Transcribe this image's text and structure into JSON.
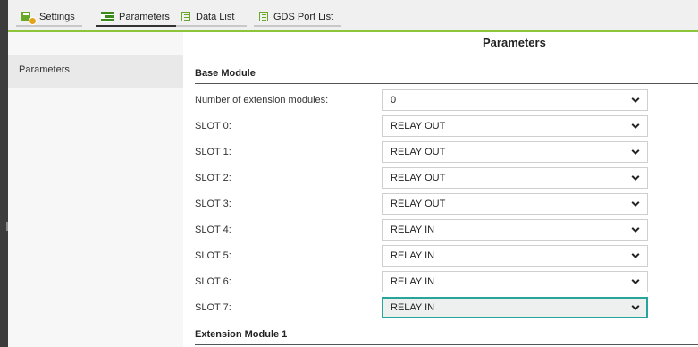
{
  "tabs": [
    {
      "label": "Settings",
      "icon": "settings-icon"
    },
    {
      "label": "Parameters",
      "icon": "parameters-icon"
    },
    {
      "label": "Data List",
      "icon": "list-icon"
    },
    {
      "label": "GDS Port List",
      "icon": "list-icon"
    }
  ],
  "active_tab": "Parameters",
  "page_title": "Parameters",
  "sidenav": {
    "items": [
      {
        "label": "Parameters"
      }
    ]
  },
  "base_module": {
    "title": "Base Module",
    "rows": [
      {
        "label": "Number of extension modules:",
        "value": "0"
      },
      {
        "label": "SLOT 0:",
        "value": "RELAY OUT"
      },
      {
        "label": "SLOT 1:",
        "value": "RELAY OUT"
      },
      {
        "label": "SLOT 2:",
        "value": "RELAY OUT"
      },
      {
        "label": "SLOT 3:",
        "value": "RELAY OUT"
      },
      {
        "label": "SLOT 4:",
        "value": "RELAY IN"
      },
      {
        "label": "SLOT 5:",
        "value": "RELAY IN"
      },
      {
        "label": "SLOT 6:",
        "value": "RELAY IN"
      },
      {
        "label": "SLOT 7:",
        "value": "RELAY IN"
      }
    ]
  },
  "extension_module": {
    "title": "Extension Module 1"
  },
  "colors": {
    "accent_green": "#8cc43a",
    "focus_teal": "#26a69a"
  }
}
